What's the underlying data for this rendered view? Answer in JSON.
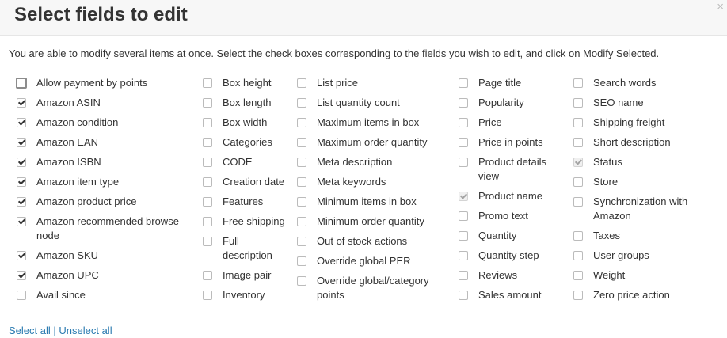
{
  "dialog": {
    "title": "Select fields to edit",
    "close_icon": "×",
    "intro": "You are able to modify several items at once. Select the check boxes corresponding to the fields you wish to edit, and click on Modify Selected."
  },
  "columns": [
    [
      {
        "label": "Allow payment by points",
        "checked": false
      },
      {
        "label": "Amazon ASIN",
        "checked": true
      },
      {
        "label": "Amazon condition",
        "checked": true
      },
      {
        "label": "Amazon EAN",
        "checked": true
      },
      {
        "label": "Amazon ISBN",
        "checked": true
      },
      {
        "label": "Amazon item type",
        "checked": true
      },
      {
        "label": "Amazon product price",
        "checked": true
      },
      {
        "label": "Amazon recommended browse node",
        "checked": true
      },
      {
        "label": "Amazon SKU",
        "checked": true
      },
      {
        "label": "Amazon UPC",
        "checked": true
      },
      {
        "label": "Avail since",
        "checked": false
      }
    ],
    [
      {
        "label": "Box height",
        "checked": false
      },
      {
        "label": "Box length",
        "checked": false
      },
      {
        "label": "Box width",
        "checked": false
      },
      {
        "label": "Categories",
        "checked": false
      },
      {
        "label": "CODE",
        "checked": false
      },
      {
        "label": "Creation date",
        "checked": false
      },
      {
        "label": "Features",
        "checked": false
      },
      {
        "label": "Free shipping",
        "checked": false
      },
      {
        "label": "Full description",
        "checked": false
      },
      {
        "label": "Image pair",
        "checked": false
      },
      {
        "label": "Inventory",
        "checked": false
      }
    ],
    [
      {
        "label": "List price",
        "checked": false
      },
      {
        "label": "List quantity count",
        "checked": false
      },
      {
        "label": "Maximum items in box",
        "checked": false
      },
      {
        "label": "Maximum order quantity",
        "checked": false
      },
      {
        "label": "Meta description",
        "checked": false
      },
      {
        "label": "Meta keywords",
        "checked": false
      },
      {
        "label": "Minimum items in box",
        "checked": false
      },
      {
        "label": "Minimum order quantity",
        "checked": false
      },
      {
        "label": "Out of stock actions",
        "checked": false
      },
      {
        "label": "Override global PER",
        "checked": false
      },
      {
        "label": "Override global/category points",
        "checked": false
      }
    ],
    [
      {
        "label": "Page title",
        "checked": false
      },
      {
        "label": "Popularity",
        "checked": false
      },
      {
        "label": "Price",
        "checked": false
      },
      {
        "label": "Price in points",
        "checked": false
      },
      {
        "label": "Product details view",
        "checked": false
      },
      {
        "label": "Product name",
        "checked": true,
        "disabled": true
      },
      {
        "label": "Promo text",
        "checked": false
      },
      {
        "label": "Quantity",
        "checked": false
      },
      {
        "label": "Quantity step",
        "checked": false
      },
      {
        "label": "Reviews",
        "checked": false
      },
      {
        "label": "Sales amount",
        "checked": false
      }
    ],
    [
      {
        "label": "Search words",
        "checked": false
      },
      {
        "label": "SEO name",
        "checked": false
      },
      {
        "label": "Shipping freight",
        "checked": false
      },
      {
        "label": "Short description",
        "checked": false
      },
      {
        "label": "Status",
        "checked": true,
        "disabled": true
      },
      {
        "label": "Store",
        "checked": false
      },
      {
        "label": "Synchronization with Amazon",
        "checked": false
      },
      {
        "label": "Taxes",
        "checked": false
      },
      {
        "label": "User groups",
        "checked": false
      },
      {
        "label": "Weight",
        "checked": false
      },
      {
        "label": "Zero price action",
        "checked": false
      }
    ]
  ],
  "footer": {
    "select_all": "Select all",
    "separator": "|",
    "unselect_all": "Unselect all"
  },
  "colors": {
    "link": "#2a7ab0",
    "header_bg": "#f7f7f7"
  }
}
